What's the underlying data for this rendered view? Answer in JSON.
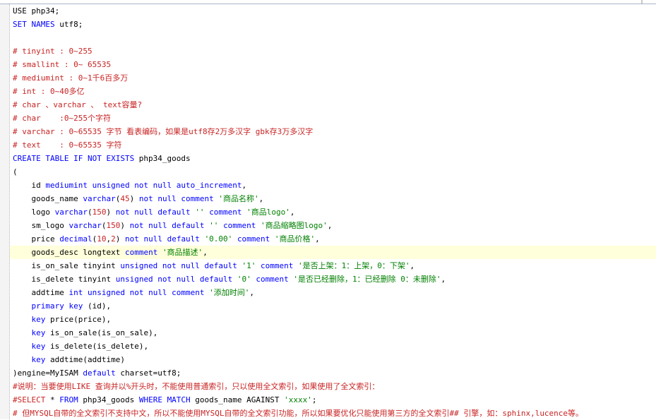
{
  "colors": {
    "keyword": "#0000ff",
    "comment": "#c82323",
    "string": "#008000",
    "text": "#000000",
    "current_line": "#ffffdb"
  },
  "lines": [
    [
      [
        "t",
        "USE php34;"
      ]
    ],
    [
      [
        "k",
        "SET NAMES"
      ],
      [
        "t",
        " utf8;"
      ]
    ],
    [],
    [
      [
        "c",
        "# tinyint : 0~255"
      ]
    ],
    [
      [
        "c",
        "# smallint : 0~ 65535"
      ]
    ],
    [
      [
        "c",
        "# mediumint : 0~1千6百多万"
      ]
    ],
    [
      [
        "c",
        "# int : 0~40多亿"
      ]
    ],
    [
      [
        "c",
        "# char 、varchar 、 text容量?"
      ]
    ],
    [
      [
        "c",
        "# char    :0~255个字符"
      ]
    ],
    [
      [
        "c",
        "# varchar : 0~65535 字节 看表编码，如果是utf8存2万多汉字 gbk存3万多汉字"
      ]
    ],
    [
      [
        "c",
        "# text    : 0~65535 字符"
      ]
    ],
    [
      [
        "k",
        "CREATE TABLE IF NOT EXISTS"
      ],
      [
        "t",
        " php34_goods"
      ]
    ],
    [
      [
        "t",
        "("
      ]
    ],
    [
      [
        "t",
        "    id "
      ],
      [
        "k",
        "mediumint unsigned not null auto_increment"
      ],
      [
        "t",
        ","
      ]
    ],
    [
      [
        "t",
        "    goods_name "
      ],
      [
        "k",
        "varchar"
      ],
      [
        "t",
        "("
      ],
      [
        "c",
        "45"
      ],
      [
        "t",
        ") "
      ],
      [
        "k",
        "not null comment"
      ],
      [
        "t",
        " "
      ],
      [
        "s",
        "'商品名称'"
      ],
      [
        "t",
        ","
      ]
    ],
    [
      [
        "t",
        "    logo "
      ],
      [
        "k",
        "varchar"
      ],
      [
        "t",
        "("
      ],
      [
        "c",
        "150"
      ],
      [
        "t",
        ") "
      ],
      [
        "k",
        "not null default"
      ],
      [
        "t",
        " "
      ],
      [
        "s",
        "''"
      ],
      [
        "t",
        " "
      ],
      [
        "k",
        "comment"
      ],
      [
        "t",
        " "
      ],
      [
        "s",
        "'商品logo'"
      ],
      [
        "t",
        ","
      ]
    ],
    [
      [
        "t",
        "    sm_logo "
      ],
      [
        "k",
        "varchar"
      ],
      [
        "t",
        "("
      ],
      [
        "c",
        "150"
      ],
      [
        "t",
        ") "
      ],
      [
        "k",
        "not null default"
      ],
      [
        "t",
        " "
      ],
      [
        "s",
        "''"
      ],
      [
        "t",
        " "
      ],
      [
        "k",
        "comment"
      ],
      [
        "t",
        " "
      ],
      [
        "s",
        "'商品缩略图logo'"
      ],
      [
        "t",
        ","
      ]
    ],
    [
      [
        "t",
        "    price "
      ],
      [
        "k",
        "decimal"
      ],
      [
        "t",
        "("
      ],
      [
        "c",
        "10"
      ],
      [
        "t",
        ","
      ],
      [
        "c",
        "2"
      ],
      [
        "t",
        ") "
      ],
      [
        "k",
        "not null default"
      ],
      [
        "t",
        " "
      ],
      [
        "s",
        "'0.00'"
      ],
      [
        "t",
        " "
      ],
      [
        "k",
        "comment"
      ],
      [
        "t",
        " "
      ],
      [
        "s",
        "'商品价格'"
      ],
      [
        "t",
        ","
      ]
    ],
    [
      [
        "t",
        "    goods_desc longtext "
      ],
      [
        "k",
        "comment"
      ],
      [
        "t",
        " "
      ],
      [
        "s",
        "'商品描述'"
      ],
      [
        "t",
        ","
      ]
    ],
    [
      [
        "t",
        "    is_on_sale tinyint "
      ],
      [
        "k",
        "unsigned not null default"
      ],
      [
        "t",
        " "
      ],
      [
        "s",
        "'1'"
      ],
      [
        "t",
        " "
      ],
      [
        "k",
        "comment"
      ],
      [
        "t",
        " "
      ],
      [
        "s",
        "'是否上架：1：上架，0：下架'"
      ],
      [
        "t",
        ","
      ]
    ],
    [
      [
        "t",
        "    is_delete tinyint "
      ],
      [
        "k",
        "unsigned not null default"
      ],
      [
        "t",
        " "
      ],
      [
        "s",
        "'0'"
      ],
      [
        "t",
        " "
      ],
      [
        "k",
        "comment"
      ],
      [
        "t",
        " "
      ],
      [
        "s",
        "'是否已经删除，1：已经删除 0：未删除'"
      ],
      [
        "t",
        ","
      ]
    ],
    [
      [
        "t",
        "    addtime "
      ],
      [
        "k",
        "int unsigned not null comment"
      ],
      [
        "t",
        " "
      ],
      [
        "s",
        "'添加时间'"
      ],
      [
        "t",
        ","
      ]
    ],
    [
      [
        "t",
        "    "
      ],
      [
        "k",
        "primary key"
      ],
      [
        "t",
        " (id),"
      ]
    ],
    [
      [
        "t",
        "    "
      ],
      [
        "k",
        "key"
      ],
      [
        "t",
        " price(price),"
      ]
    ],
    [
      [
        "t",
        "    "
      ],
      [
        "k",
        "key"
      ],
      [
        "t",
        " is_on_sale(is_on_sale),"
      ]
    ],
    [
      [
        "t",
        "    "
      ],
      [
        "k",
        "key"
      ],
      [
        "t",
        " is_delete(is_delete),"
      ]
    ],
    [
      [
        "t",
        "    "
      ],
      [
        "k",
        "key"
      ],
      [
        "t",
        " addtime(addtime)"
      ]
    ],
    [
      [
        "t",
        ")engine=MyISAM "
      ],
      [
        "k",
        "default"
      ],
      [
        "t",
        " charset=utf8;"
      ]
    ],
    [
      [
        "c",
        "#说明：当要使用LIKE 查询并以%开头时，不能使用普通索引，只以使用全文索引，如果使用了全文索引："
      ]
    ],
    [
      [
        "c",
        "#SELECT"
      ],
      [
        "t",
        " * "
      ],
      [
        "k",
        "FROM"
      ],
      [
        "t",
        " php34_goods "
      ],
      [
        "k",
        "WHERE MATCH"
      ],
      [
        "t",
        " goods_name AGAINST "
      ],
      [
        "s",
        "'xxxx'"
      ],
      [
        "t",
        ";"
      ]
    ],
    [
      [
        "c",
        "# 但MYSQL自带的全文索引不支持中文，所以不能使用MYSQL自带的全文索引功能，所以如果要优化只能使用第三方的全文索引## 引擎，如：sphinx,lucence等。"
      ]
    ]
  ],
  "highlighted_line": 18
}
